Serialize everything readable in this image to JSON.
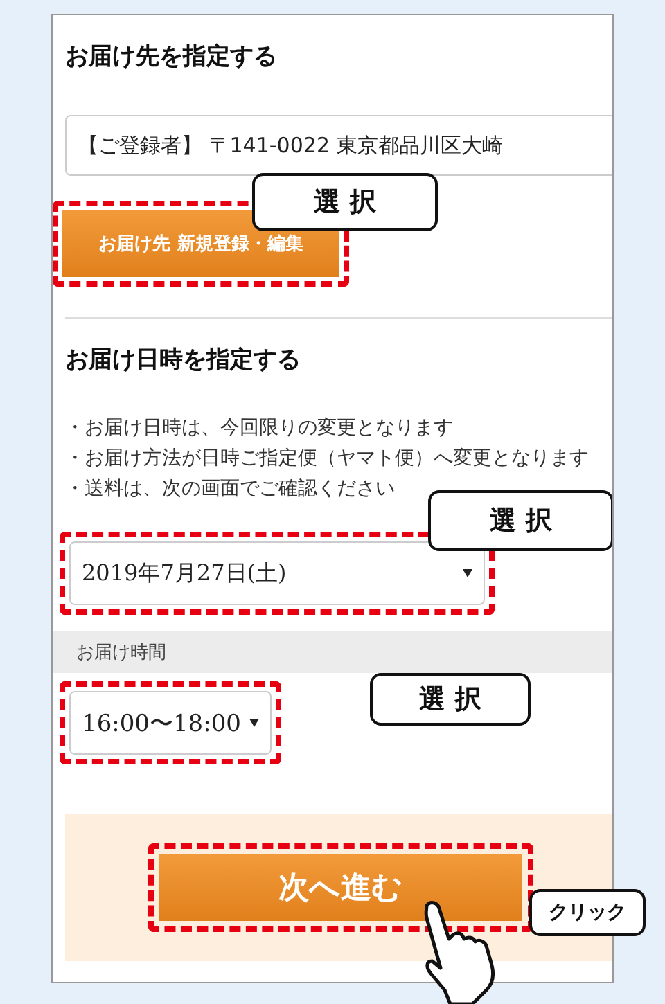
{
  "address_section": {
    "heading": "お届け先を指定する",
    "address": "【ご登録者】 〒141-0022 東京都品川区大崎",
    "button": "お届け先 新規登録・編集"
  },
  "datetime_section": {
    "heading": "お届け日時を指定する",
    "notes": [
      "・お届け日時は、今回限りの変更となります",
      "・お届け方法が日時ご指定便（ヤマト便）へ変更となります",
      "・送料は、次の画面でご確認ください"
    ],
    "date_select": {
      "value": "2019年7月27日(土)"
    },
    "time_label": "お届け時間",
    "time_select": {
      "value": "16:00〜18:00"
    }
  },
  "next_button": "次へ進む",
  "callouts": [
    "選 択",
    "選 択",
    "選 択",
    "クリック"
  ]
}
